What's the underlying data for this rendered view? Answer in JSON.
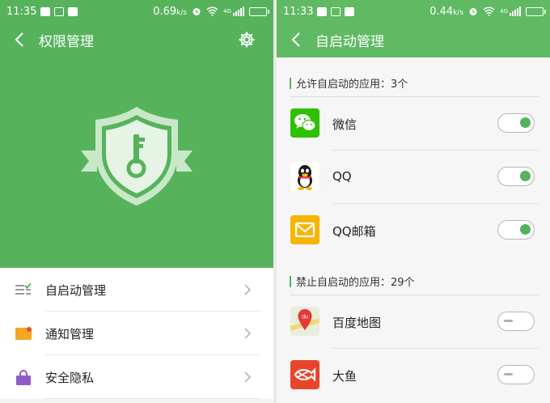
{
  "left": {
    "status": {
      "time": "11:35",
      "speed": "0.69",
      "speed_unit": "k/s",
      "net": "4G"
    },
    "title": "权限管理",
    "menu": [
      {
        "label": "自启动管理",
        "icon": "autostart-list-icon"
      },
      {
        "label": "通知管理",
        "icon": "notification-icon"
      },
      {
        "label": "安全隐私",
        "icon": "lock-icon"
      }
    ]
  },
  "right": {
    "status": {
      "time": "11:33",
      "speed": "0.44",
      "speed_unit": "k/s",
      "net": "4G"
    },
    "title": "自启动管理",
    "allowed_header": "允许自启动的应用：3个",
    "denied_header": "禁止自启动的应用：29个",
    "allowed_apps": [
      {
        "name": "微信",
        "enabled": true
      },
      {
        "name": "QQ",
        "enabled": true
      },
      {
        "name": "QQ邮箱",
        "enabled": true
      }
    ],
    "denied_apps": [
      {
        "name": "百度地图",
        "enabled": false,
        "icon_text": "du"
      },
      {
        "name": "大鱼",
        "enabled": false
      }
    ]
  },
  "colors": {
    "primary_green": "#56b35c",
    "header_green": "#5fba63"
  }
}
